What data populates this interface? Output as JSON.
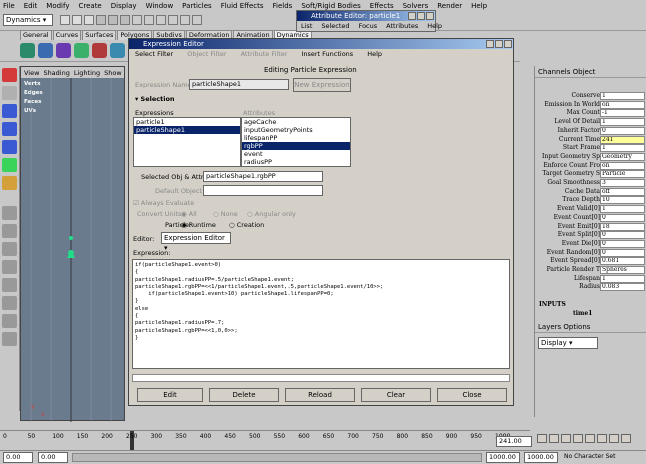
{
  "menus": [
    "File",
    "Edit",
    "Modify",
    "Create",
    "Display",
    "Window",
    "Particles",
    "Fluid Effects",
    "Fields",
    "Soft/Rigid Bodies",
    "Effects",
    "Solvers",
    "Render",
    "Help"
  ],
  "menu_mode": "Dynamics",
  "shelf_tabs": [
    "General",
    "Curves",
    "Surfaces",
    "Polygons",
    "Subdivs",
    "Deformation",
    "Animation",
    "Dynamics"
  ],
  "viewport": {
    "menus": [
      "View",
      "Shading",
      "Lighting",
      "Show"
    ],
    "attrs": [
      "Vertx",
      "Edges",
      "Faces",
      "UVs"
    ],
    "axis_x": "x",
    "axis_y": "y"
  },
  "attr_editor": {
    "title": "Attribute Editor: particle1",
    "menus": [
      "List",
      "Selected",
      "Focus",
      "Attributes",
      "Help"
    ]
  },
  "expr_editor": {
    "title": "Expression Editor",
    "menus": [
      "Select Filter",
      "Object Filter",
      "Attribute Filter",
      "Insert Functions",
      "Help"
    ],
    "heading": "Editing Particle Expression",
    "expr_name_label": "Expression Name",
    "expr_name_value": "particleShape1",
    "new_expression": "New Expression",
    "selection_label": "Selection",
    "expressions_label": "Expressions",
    "attributes_label": "Attributes",
    "expressions": [
      "particle1",
      "particleShape1"
    ],
    "attributes": [
      "ageCache",
      "inputGeometryPoints",
      "lifespanPP",
      "rgbPP",
      "event",
      "radiusPP"
    ],
    "selected_obj_label": "Selected Obj & Attr",
    "selected_obj_value": "particleShape1.rgbPP",
    "default_object_label": "Default Object",
    "always_evaluate": "Always Evaluate",
    "convert_units_label": "Convert Units:",
    "convert_all": "All",
    "convert_none": "None",
    "convert_angular": "Angular only",
    "particle_label": "Particle:",
    "runtime": "Runtime",
    "creation": "Creation",
    "editor_label": "Editor:",
    "editor_value": "Expression Editor",
    "expression_label": "Expression:",
    "code": "if(particleShape1.event>0)\n{\nparticleShape1.radiusPP=.5/particleShape1.event;\nparticleShape1.rgbPP=<<1/particleShape1.event,.5,particleShape1.event/10>>;\n    if(particleShape1.event>10) particleShape1.lifespanPP=0;\n}\nelse\n{\nparticleShape1.radiusPP=.7;\nparticleShape1.rgbPP=<<1,0,0>>;\n}",
    "buttons": [
      "Edit",
      "Delete",
      "Reload",
      "Clear",
      "Close"
    ]
  },
  "channel_box": {
    "title": "Channels  Object",
    "rows": [
      {
        "k": "Conserve",
        "v": "1"
      },
      {
        "k": "Emission In World",
        "v": "on"
      },
      {
        "k": "Max Count",
        "v": "-1"
      },
      {
        "k": "Level Of Detail",
        "v": "1"
      },
      {
        "k": "Inherit Factor",
        "v": "0"
      },
      {
        "k": "Current Time",
        "v": "241"
      },
      {
        "k": "Start Frame",
        "v": "1"
      },
      {
        "k": "Input Geometry Sp",
        "v": "Geometry"
      },
      {
        "k": "Enforce Count Fro",
        "v": "on"
      },
      {
        "k": "Target Geometry S",
        "v": "Particle"
      },
      {
        "k": "Goal Smoothness",
        "v": "3"
      },
      {
        "k": "Cache Data",
        "v": "off"
      },
      {
        "k": "Trace Depth",
        "v": "10"
      },
      {
        "k": "Event Valid[0]",
        "v": "1"
      },
      {
        "k": "Event Count[0]",
        "v": "0"
      },
      {
        "k": "Event Emit[0]",
        "v": "18"
      },
      {
        "k": "Event Split[0]",
        "v": "0"
      },
      {
        "k": "Event Die[0]",
        "v": "0"
      },
      {
        "k": "Event Random[0]",
        "v": "0"
      },
      {
        "k": "Event Spread[0]",
        "v": "0.681"
      },
      {
        "k": "Particle Render T",
        "v": "Spheres"
      },
      {
        "k": "Lifespan",
        "v": "1"
      },
      {
        "k": "Radius",
        "v": "0.083"
      }
    ],
    "inputs_label": "INPUTS",
    "input_item": "time1"
  },
  "layers": {
    "title": "Layers  Options",
    "display": "Display"
  },
  "timeline": {
    "ticks": [
      "0",
      "50",
      "100",
      "150",
      "200",
      "250",
      "300",
      "350",
      "400",
      "450",
      "500",
      "550",
      "600",
      "650",
      "700",
      "750",
      "800",
      "850",
      "900",
      "950",
      "1000"
    ],
    "current": "241.00",
    "range_start": "0.00",
    "range_start2": "0.00",
    "range_end": "1000.00",
    "range_end2": "1000.00",
    "character": "No Character Set"
  }
}
